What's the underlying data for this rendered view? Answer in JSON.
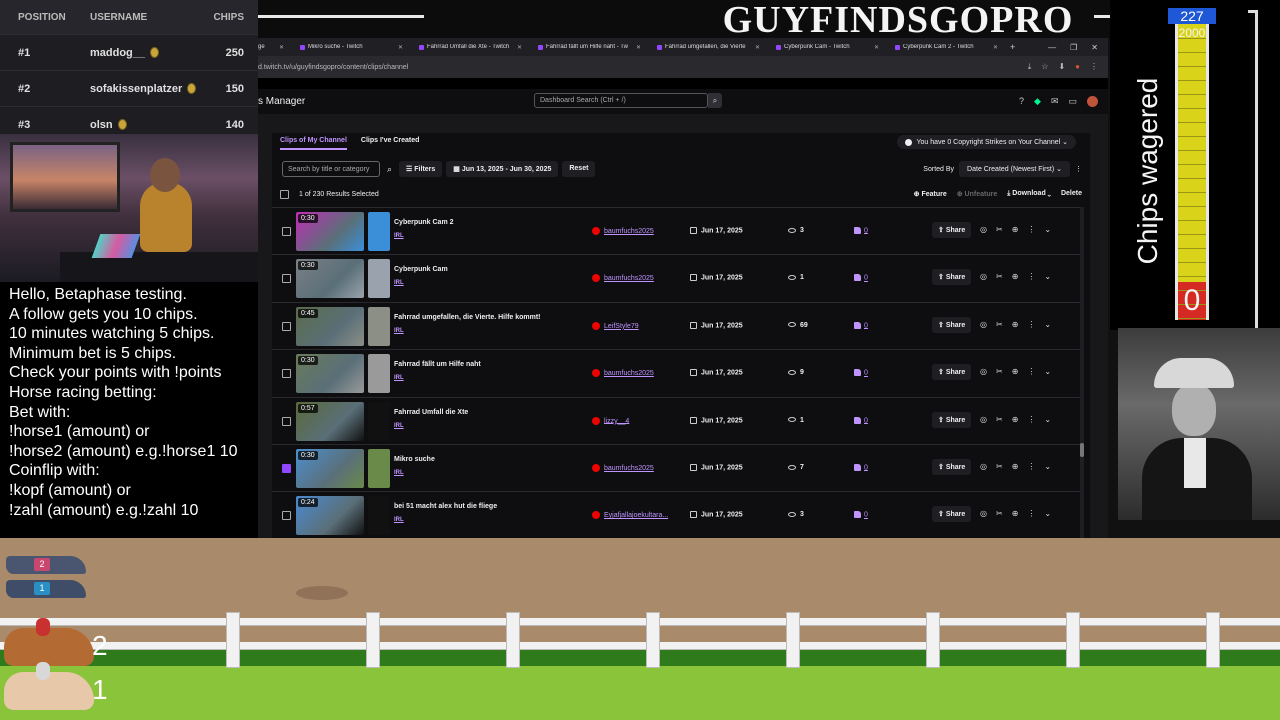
{
  "stream": {
    "title": "GUYFINDSGOPRO"
  },
  "leaderboard": {
    "headers": {
      "position": "POSITION",
      "username": "USERNAME",
      "chips": "CHIPS"
    },
    "rows": [
      {
        "position": "#1",
        "username": "maddog__",
        "chips": "250"
      },
      {
        "position": "#2",
        "username": "sofakissenplatzer",
        "chips": "150"
      },
      {
        "position": "#3",
        "username": "olsn",
        "chips": "140"
      }
    ]
  },
  "chat": {
    "lines": [
      "Hello, Betaphase testing.",
      "A follow gets you 10 chips.",
      "10 minutes watching 5 chips.",
      "Minimum bet is 5 chips.",
      "Check your points with !points",
      "Horse racing betting:",
      "Bet with:",
      "!horse1 (amount) or",
      "!horse2 (amount) e.g.!horse1 10",
      "Coinflip with:",
      "!kopf (amount) or",
      "!zahl (amount) e.g.!zahl 10"
    ]
  },
  "browser": {
    "tabs": [
      {
        "label": "Mikro suche - Twitch"
      },
      {
        "label": "Fahrrad Umfall die Xte - Twitch"
      },
      {
        "label": "Fahrrad fällt um Hilfe naht - Tw"
      },
      {
        "label": "Fahrrad umgefallen, die Vierte"
      },
      {
        "label": "Cyberpunk Cam - Twitch"
      },
      {
        "label": "Cyberpunk Cam 2 - Twitch"
      }
    ],
    "new_tab": "+",
    "url": "d.twitch.tv/u/guyfindsgopro/content/clips/channel",
    "dashboard_title": "s Manager",
    "dashboard_search_placeholder": "Dashboard Search (Ctrl + /)",
    "subtabs": {
      "my_channel": "Clips of My Channel",
      "created": "Clips I've Created"
    },
    "copyright": "You have 0 Copyright Strikes on Your Channel",
    "filters": {
      "search_placeholder": "Search by title or category",
      "filters_label": "Filters",
      "date_range": "Jun 13, 2025 - Jun 30, 2025",
      "reset_label": "Reset",
      "sorted_by_label": "Sorted By",
      "sort_value": "Date Created (Newest First)"
    },
    "selection": {
      "count_text": "1 of 230 Results Selected",
      "feature": "Feature",
      "unfeature": "Unfeature",
      "download": "Download",
      "delete": "Delete"
    },
    "share_label": "Share",
    "clips": [
      {
        "duration": "0:30",
        "title": "Cyberpunk Cam 2",
        "category": "IRL",
        "creator": "baumfuchs2025",
        "date": "Jun 17, 2025",
        "views": "3",
        "likes": "0",
        "selected": false
      },
      {
        "duration": "0:30",
        "title": "Cyberpunk Cam",
        "category": "IRL",
        "creator": "baumfuchs2025",
        "date": "Jun 17, 2025",
        "views": "1",
        "likes": "0",
        "selected": false
      },
      {
        "duration": "0:45",
        "title": "Fahrrad umgefallen, die Vierte. Hilfe kommt!",
        "category": "IRL",
        "creator": "LeifStyle79",
        "date": "Jun 17, 2025",
        "views": "69",
        "likes": "0",
        "selected": false
      },
      {
        "duration": "0:30",
        "title": "Fahrrad fällt um Hilfe naht",
        "category": "IRL",
        "creator": "baumfuchs2025",
        "date": "Jun 17, 2025",
        "views": "9",
        "likes": "0",
        "selected": false
      },
      {
        "duration": "0:57",
        "title": "Fahrrad Umfall die Xte",
        "category": "IRL",
        "creator": "lizzy__4",
        "date": "Jun 17, 2025",
        "views": "1",
        "likes": "0",
        "selected": false
      },
      {
        "duration": "0:30",
        "title": "Mikro suche",
        "category": "IRL",
        "creator": "baumfuchs2025",
        "date": "Jun 17, 2025",
        "views": "7",
        "likes": "0",
        "selected": true
      },
      {
        "duration": "0:24",
        "title": "bei 51 macht alex hut die fliege",
        "category": "IRL",
        "creator": "Eyjafjallajoekultara...",
        "date": "Jun 17, 2025",
        "views": "3",
        "likes": "0",
        "selected": false
      }
    ]
  },
  "wager": {
    "label": "Chips wagered",
    "top_value": "227",
    "max_value": "2000",
    "current_value": "0"
  },
  "race": {
    "dogs": [
      {
        "number": "2",
        "color": "#c9466f"
      },
      {
        "number": "1",
        "color": "#2a8fc2"
      }
    ],
    "horses": [
      {
        "number": "2"
      },
      {
        "number": "1"
      }
    ]
  }
}
